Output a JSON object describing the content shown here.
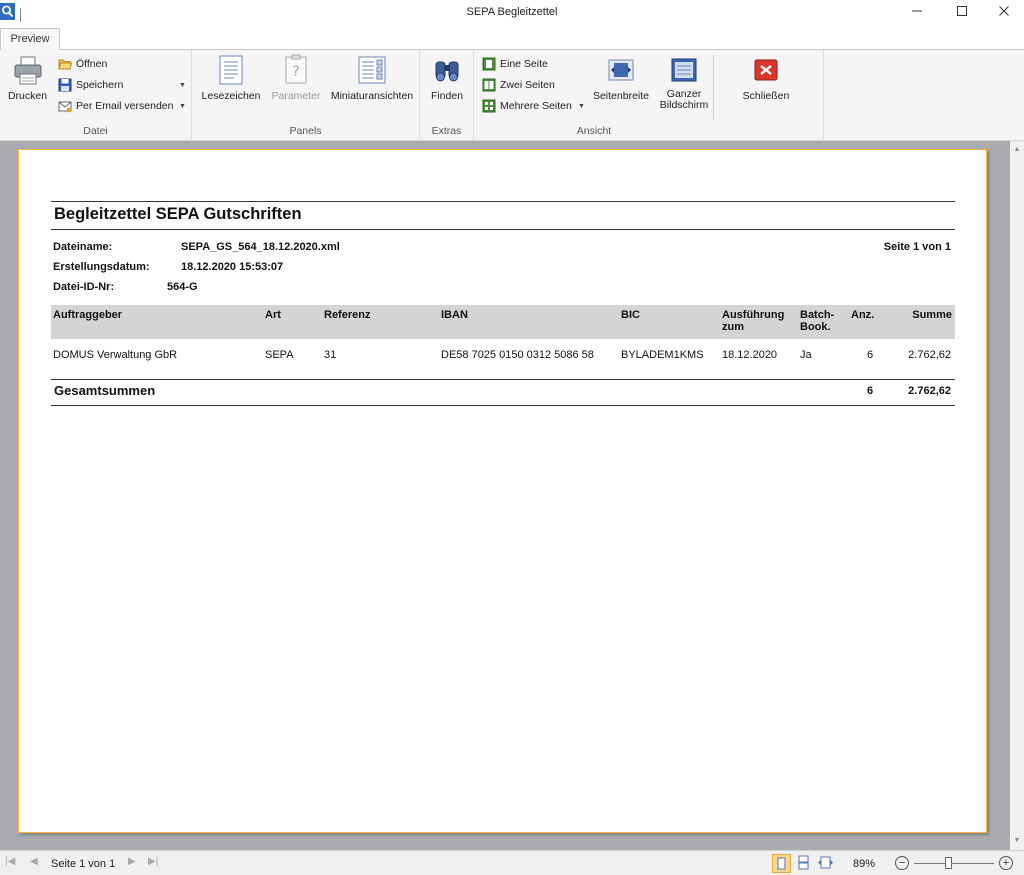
{
  "window": {
    "title": "SEPA Begleitzettel",
    "app_icon": "magnifier-app-icon",
    "minimize_glyph": "—",
    "maximize_glyph": "☐",
    "close_glyph": "✕"
  },
  "tabs": [
    {
      "label": "Preview",
      "active": true
    }
  ],
  "ribbon": {
    "datei": {
      "label": "Datei",
      "print": "Drucken",
      "open": "Öffnen",
      "save": "Speichern",
      "email": "Per Email versenden"
    },
    "panels": {
      "label": "Panels",
      "bookmarks": "Lesezeichen",
      "parameter": "Parameter",
      "thumbnails": "Miniaturansichten"
    },
    "extras": {
      "label": "Extras",
      "find": "Finden"
    },
    "ansicht": {
      "label": "Ansicht",
      "one_page": "Eine Seite",
      "two_pages": "Zwei Seiten",
      "multi_pages": "Mehrere Seiten",
      "page_width": "Seitenbreite",
      "whole_line1": "Ganzer",
      "whole_line2": "Bildschirm"
    },
    "close": "Schließen"
  },
  "report": {
    "title": "Begleitzettel SEPA Gutschriften",
    "page_info": "Seite 1 von 1",
    "meta": {
      "filename_label": "Dateiname:",
      "filename": "SEPA_GS_564_18.12.2020.xml",
      "created_label": "Erstellungsdatum:",
      "created": "18.12.2020 15:53:07",
      "fileid_label": "Datei-ID-Nr:",
      "fileid": "564-G"
    },
    "columns": {
      "auftraggeber": "Auftraggeber",
      "art": "Art",
      "referenz": "Referenz",
      "iban": "IBAN",
      "bic": "BIC",
      "ausfuehrung_1": "Ausführung",
      "ausfuehrung_2": "zum",
      "batch_1": "Batch-",
      "batch_2": "Book.",
      "anz": "Anz.",
      "summe": "Summe"
    },
    "rows": [
      {
        "auftraggeber": "DOMUS Verwaltung GbR",
        "art": "SEPA",
        "referenz": "31",
        "iban": "DE58 7025 0150 0312 5086 58",
        "bic": "BYLADEM1KMS",
        "ausfuehrung": "18.12.2020",
        "batch": "Ja",
        "anz": "6",
        "summe": "2.762,62"
      }
    ],
    "totals": {
      "label": "Gesamtsummen",
      "anz": "6",
      "summe": "2.762,62"
    }
  },
  "statusbar": {
    "page_text": "Seite 1 von 1",
    "zoom": "89%",
    "zoom_level_percent": 89
  }
}
